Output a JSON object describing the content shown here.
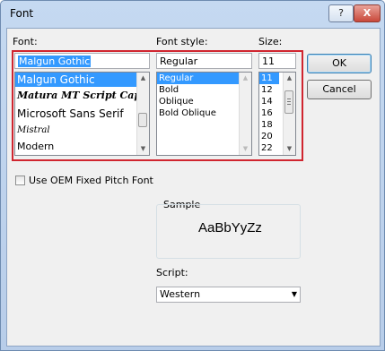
{
  "window": {
    "title": "Font",
    "help_label": "?",
    "close_label": "X"
  },
  "labels": {
    "font": "Font:",
    "font_style": "Font style:",
    "size": "Size:"
  },
  "font": {
    "value": "Malgun Gothic",
    "items": [
      {
        "label": "Malgun Gothic",
        "selected": true
      },
      {
        "label": "Matura MT Script Capitals",
        "selected": false
      },
      {
        "label": "Microsoft Sans Serif",
        "selected": false
      },
      {
        "label": "Mistral",
        "selected": false
      },
      {
        "label": "Modern",
        "selected": false
      }
    ]
  },
  "style": {
    "value": "Regular",
    "items": [
      {
        "label": "Regular",
        "selected": true
      },
      {
        "label": "Bold",
        "selected": false
      },
      {
        "label": "Oblique",
        "selected": false
      },
      {
        "label": "Bold Oblique",
        "selected": false
      }
    ]
  },
  "size": {
    "value": "11",
    "items": [
      {
        "label": "11",
        "selected": true
      },
      {
        "label": "12",
        "selected": false
      },
      {
        "label": "14",
        "selected": false
      },
      {
        "label": "16",
        "selected": false
      },
      {
        "label": "18",
        "selected": false
      },
      {
        "label": "20",
        "selected": false
      },
      {
        "label": "22",
        "selected": false
      }
    ]
  },
  "buttons": {
    "ok": "OK",
    "cancel": "Cancel"
  },
  "oem_checkbox": {
    "label": "Use OEM Fixed Pitch Font",
    "checked": false
  },
  "sample": {
    "label": "Sample",
    "text": "AaBbYyZz"
  },
  "script": {
    "label": "Script:",
    "value": "Western"
  },
  "colors": {
    "highlight": "#3399ff",
    "annotation_border": "#d0252f"
  }
}
